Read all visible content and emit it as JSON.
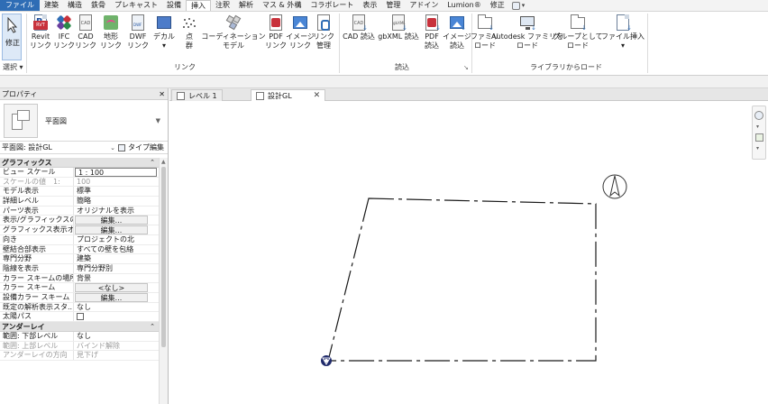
{
  "menu": {
    "tabs": [
      "ファイル",
      "建築",
      "構造",
      "鉄骨",
      "プレキャスト",
      "設備",
      "挿入",
      "注釈",
      "解析",
      "マス & 外構",
      "コラボレート",
      "表示",
      "管理",
      "アドイン",
      "Lumion®",
      "修正"
    ],
    "active_tab": "挿入"
  },
  "ribbon": {
    "select": {
      "top": "修正",
      "bottom": "選択 ▾"
    },
    "link_buttons": [
      {
        "label": "Revit\nリンク",
        "icon": "revit-link-icon"
      },
      {
        "label": "IFC\nリンク",
        "icon": "ifc-link-icon"
      },
      {
        "label": "CAD\nリンク",
        "icon": "cad-link-icon"
      },
      {
        "label": "地形\nリンク",
        "icon": "topography-link-icon"
      },
      {
        "label": "DWF\nリンク",
        "icon": "dwf-link-icon"
      },
      {
        "label": "デカル\n▾",
        "icon": "decal-icon"
      },
      {
        "label": "点\n群",
        "icon": "point-cloud-icon"
      },
      {
        "label": "コーディネーション\nモデル",
        "icon": "coordination-model-icon"
      },
      {
        "label": "PDF\nリンク",
        "icon": "pdf-link-icon"
      },
      {
        "label": "イメージ\nリンク",
        "icon": "image-link-icon"
      },
      {
        "label": "リンク\n管理",
        "icon": "manage-links-icon"
      }
    ],
    "link_panel": "リンク",
    "import_buttons": [
      {
        "label": "CAD 読込",
        "icon": "cad-import-icon"
      },
      {
        "label": "gbXML 読込",
        "icon": "gbxml-import-icon"
      },
      {
        "label": "PDF\n読込",
        "icon": "pdf-import-icon"
      },
      {
        "label": "イメージ\n読込",
        "icon": "image-import-icon"
      }
    ],
    "import_panel": "読込",
    "library_buttons": [
      {
        "label": "ファミリ\nロード",
        "icon": "load-family-icon"
      },
      {
        "label": "Autodesk ファミリを\nロード",
        "icon": "autodesk-family-icon"
      },
      {
        "label": "グループとして\nロード",
        "icon": "load-group-icon"
      },
      {
        "label": "ファイル挿入\n▾",
        "icon": "insert-file-icon"
      }
    ],
    "library_panel": "ライブラリからロード"
  },
  "properties": {
    "title": "プロパティ",
    "close": "✕",
    "type_name": "平面図",
    "instance_label": "平面図: 設計GL",
    "edit_type": "タイプ編集",
    "groups": [
      {
        "name": "グラフィックス",
        "rows": [
          {
            "k": "ビュー スケール",
            "v": "1 : 100",
            "style": "box"
          },
          {
            "k": "スケールの値　1:",
            "v": "100",
            "style": "dim"
          },
          {
            "k": "モデル表示",
            "v": "標準"
          },
          {
            "k": "詳細レベル",
            "v": "簡略"
          },
          {
            "k": "パーツ表示",
            "v": "オリジナルを表示"
          },
          {
            "k": "表示/グラフィックスの...",
            "v": "編集...",
            "style": "btn"
          },
          {
            "k": "グラフィックス表示オプ...",
            "v": "編集...",
            "style": "btn"
          },
          {
            "k": "向き",
            "v": "プロジェクトの北"
          },
          {
            "k": "壁結合部表示",
            "v": "すべての壁を包絡"
          },
          {
            "k": "専門分野",
            "v": "建築"
          },
          {
            "k": "陰線を表示",
            "v": "専門分野別"
          },
          {
            "k": "カラー スキームの場所",
            "v": "背景"
          },
          {
            "k": "カラー スキーム",
            "v": "<なし>",
            "style": "btn"
          },
          {
            "k": "設備カラー スキーム",
            "v": "編集...",
            "style": "btn"
          },
          {
            "k": "既定の解析表示スタ...",
            "v": "なし"
          },
          {
            "k": "太陽パス",
            "v": "",
            "style": "check"
          }
        ]
      },
      {
        "name": "アンダーレイ",
        "rows": [
          {
            "k": "範囲: 下部レベル",
            "v": "なし"
          },
          {
            "k": "範囲: 上部レベル",
            "v": "バインド解除",
            "style": "dim"
          },
          {
            "k": "アンダーレイの方向",
            "v": "見下げ",
            "style": "dim"
          }
        ]
      }
    ]
  },
  "views": {
    "tabs": [
      {
        "label": "レベル 1",
        "active": false
      },
      {
        "label": "設計GL",
        "active": true
      }
    ],
    "close": "✕"
  },
  "colors": {
    "file_tab": "#2f6db5",
    "revit_blue": "#1e4f9c",
    "origin_marker": "#1f2a6b"
  }
}
